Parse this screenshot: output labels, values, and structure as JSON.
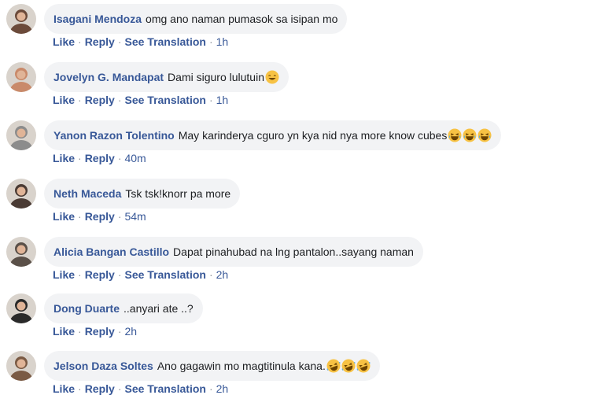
{
  "comments": [
    {
      "name": "Isagani Mendoza",
      "text": "omg ano naman pumasok sa isipan mo",
      "emojis": [],
      "actions": [
        "Like",
        "Reply",
        "See Translation"
      ],
      "time": "1h",
      "avatar_color": "#6b4a3a"
    },
    {
      "name": "Jovelyn G. Mandapat",
      "text": "Dami siguro lulutuin",
      "emojis": [
        "smiling-face-icon"
      ],
      "actions": [
        "Like",
        "Reply",
        "See Translation"
      ],
      "time": "1h",
      "avatar_color": "#c98a6a"
    },
    {
      "name": "Yanon Razon Tolentino",
      "text": "May karinderya cguro yn kya nid nya more know cubes",
      "emojis": [
        "laughing-face-icon",
        "laughing-face-icon",
        "laughing-face-icon"
      ],
      "actions": [
        "Like",
        "Reply"
      ],
      "time": "40m",
      "avatar_color": "#8c8c8c"
    },
    {
      "name": "Neth Maceda",
      "text": "Tsk tsk!knorr pa more",
      "emojis": [],
      "actions": [
        "Like",
        "Reply"
      ],
      "time": "54m",
      "avatar_color": "#4a3b34"
    },
    {
      "name": "Alicia Bangan Castillo",
      "text": "Dapat pinahubad na lng pantalon..sayang naman",
      "emojis": [],
      "actions": [
        "Like",
        "Reply",
        "See Translation"
      ],
      "time": "2h",
      "avatar_color": "#5a5048"
    },
    {
      "name": "Dong Duarte",
      "text": "..anyari ate ..?",
      "emojis": [],
      "actions": [
        "Like",
        "Reply"
      ],
      "time": "2h",
      "avatar_color": "#2a2a2a"
    },
    {
      "name": "Jelson Daza Soltes",
      "text": "Ano gagawin mo magtitinula kana.",
      "emojis": [
        "rolling-laughing-icon",
        "rolling-laughing-icon",
        "rolling-laughing-icon"
      ],
      "actions": [
        "Like",
        "Reply",
        "See Translation"
      ],
      "time": "2h",
      "avatar_color": "#7a5a44"
    }
  ]
}
